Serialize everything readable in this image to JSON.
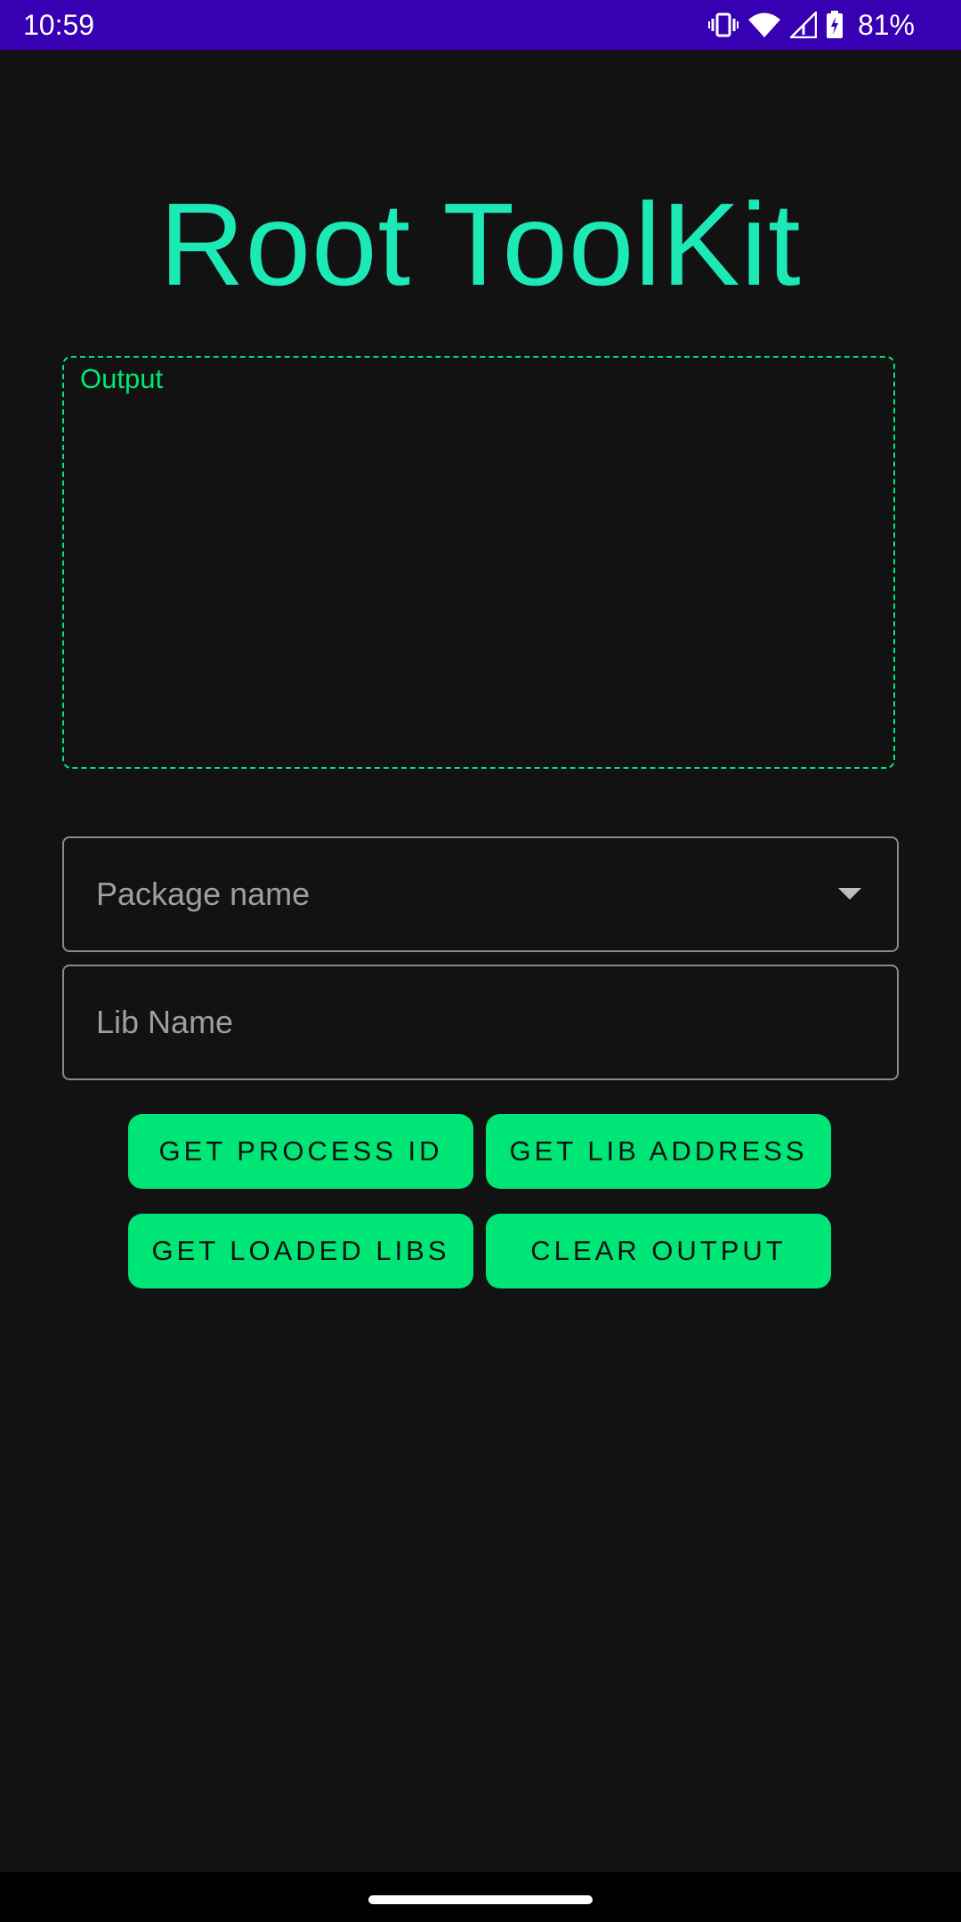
{
  "status_bar": {
    "time": "10:59",
    "battery_percent": "81%",
    "icons": [
      "vibrate-icon",
      "wifi-icon",
      "cell-signal-icon",
      "battery-charging-icon"
    ]
  },
  "app": {
    "title": "Root ToolKit"
  },
  "output": {
    "label": "Output",
    "text": ""
  },
  "fields": {
    "package_name": {
      "placeholder": "Package name",
      "value": ""
    },
    "lib_name": {
      "placeholder": "Lib Name",
      "value": ""
    }
  },
  "buttons": {
    "get_process_id": "GET PROCESS ID",
    "get_lib_address": "GET LIB ADDRESS",
    "get_loaded_libs": "GET LOADED LIBS",
    "clear_output": "CLEAR OUTPUT"
  },
  "colors": {
    "accent": "#1de9b6",
    "button": "#00e676",
    "status_bar": "#3700b3",
    "background": "#121212"
  }
}
